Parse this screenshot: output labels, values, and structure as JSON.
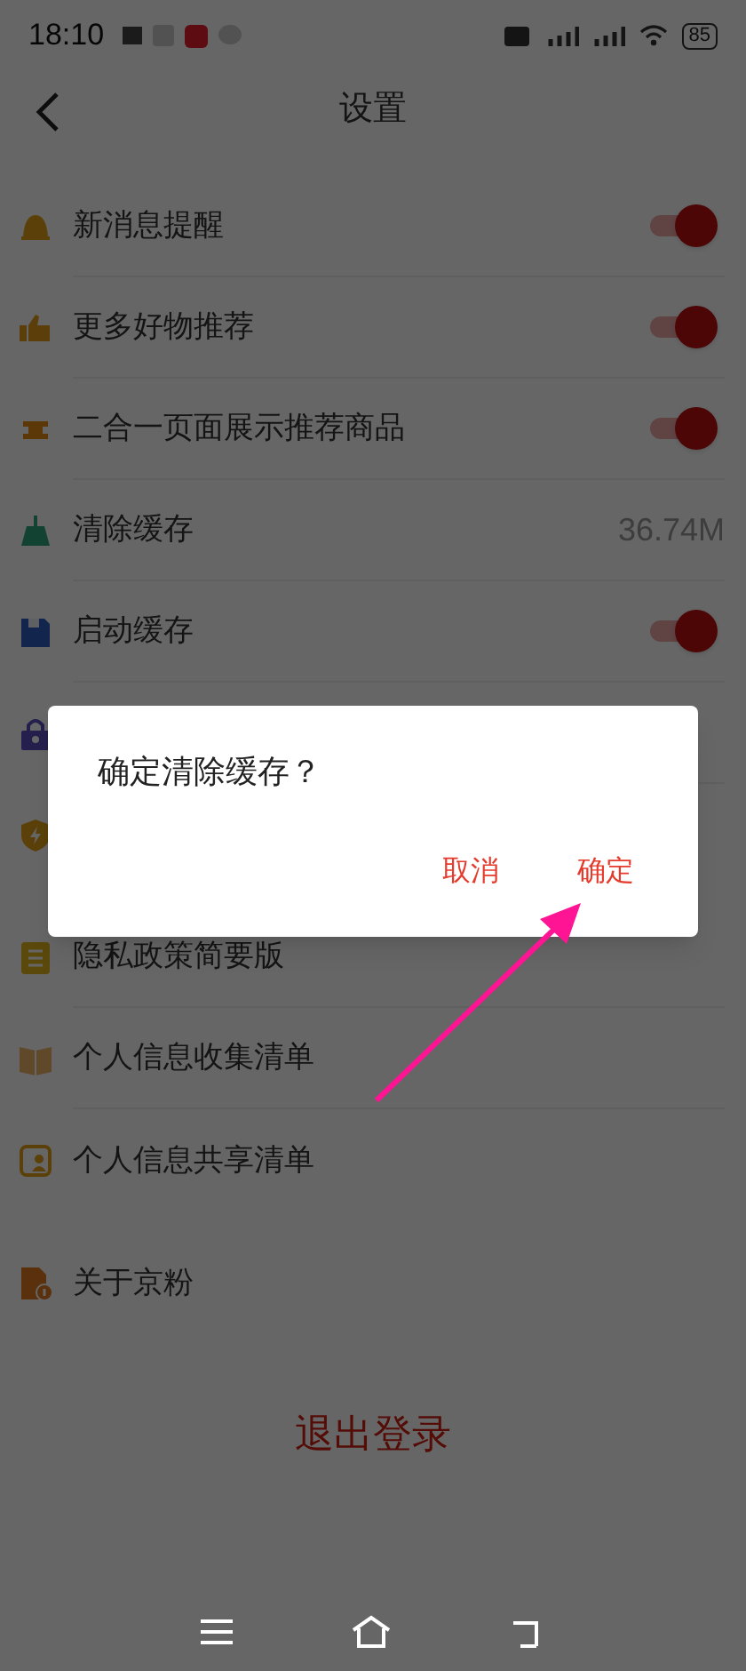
{
  "status_bar": {
    "time": "18:10",
    "battery": "85"
  },
  "header": {
    "title": "设置"
  },
  "groups": [
    {
      "items": [
        {
          "kind": "toggle",
          "label": "新消息提醒",
          "on": true
        },
        {
          "kind": "toggle",
          "label": "更多好物推荐",
          "on": true
        },
        {
          "kind": "toggle",
          "label": "二合一页面展示推荐商品",
          "on": true
        },
        {
          "kind": "value",
          "label": "清除缓存",
          "value": "36.74M"
        },
        {
          "kind": "toggle",
          "label": "启动缓存",
          "on": true
        },
        {
          "kind": "covered"
        },
        {
          "kind": "covered"
        }
      ]
    },
    {
      "items": [
        {
          "kind": "link",
          "label": "隐私政策简要版"
        },
        {
          "kind": "link",
          "label": "个人信息收集清单"
        },
        {
          "kind": "link",
          "label": "个人信息共享清单"
        }
      ]
    },
    {
      "items": [
        {
          "kind": "link",
          "label": "关于京粉"
        }
      ]
    }
  ],
  "logout": "退出登录",
  "dialog": {
    "message": "确定清除缓存？",
    "buttons": [
      "取消",
      "确定"
    ]
  }
}
